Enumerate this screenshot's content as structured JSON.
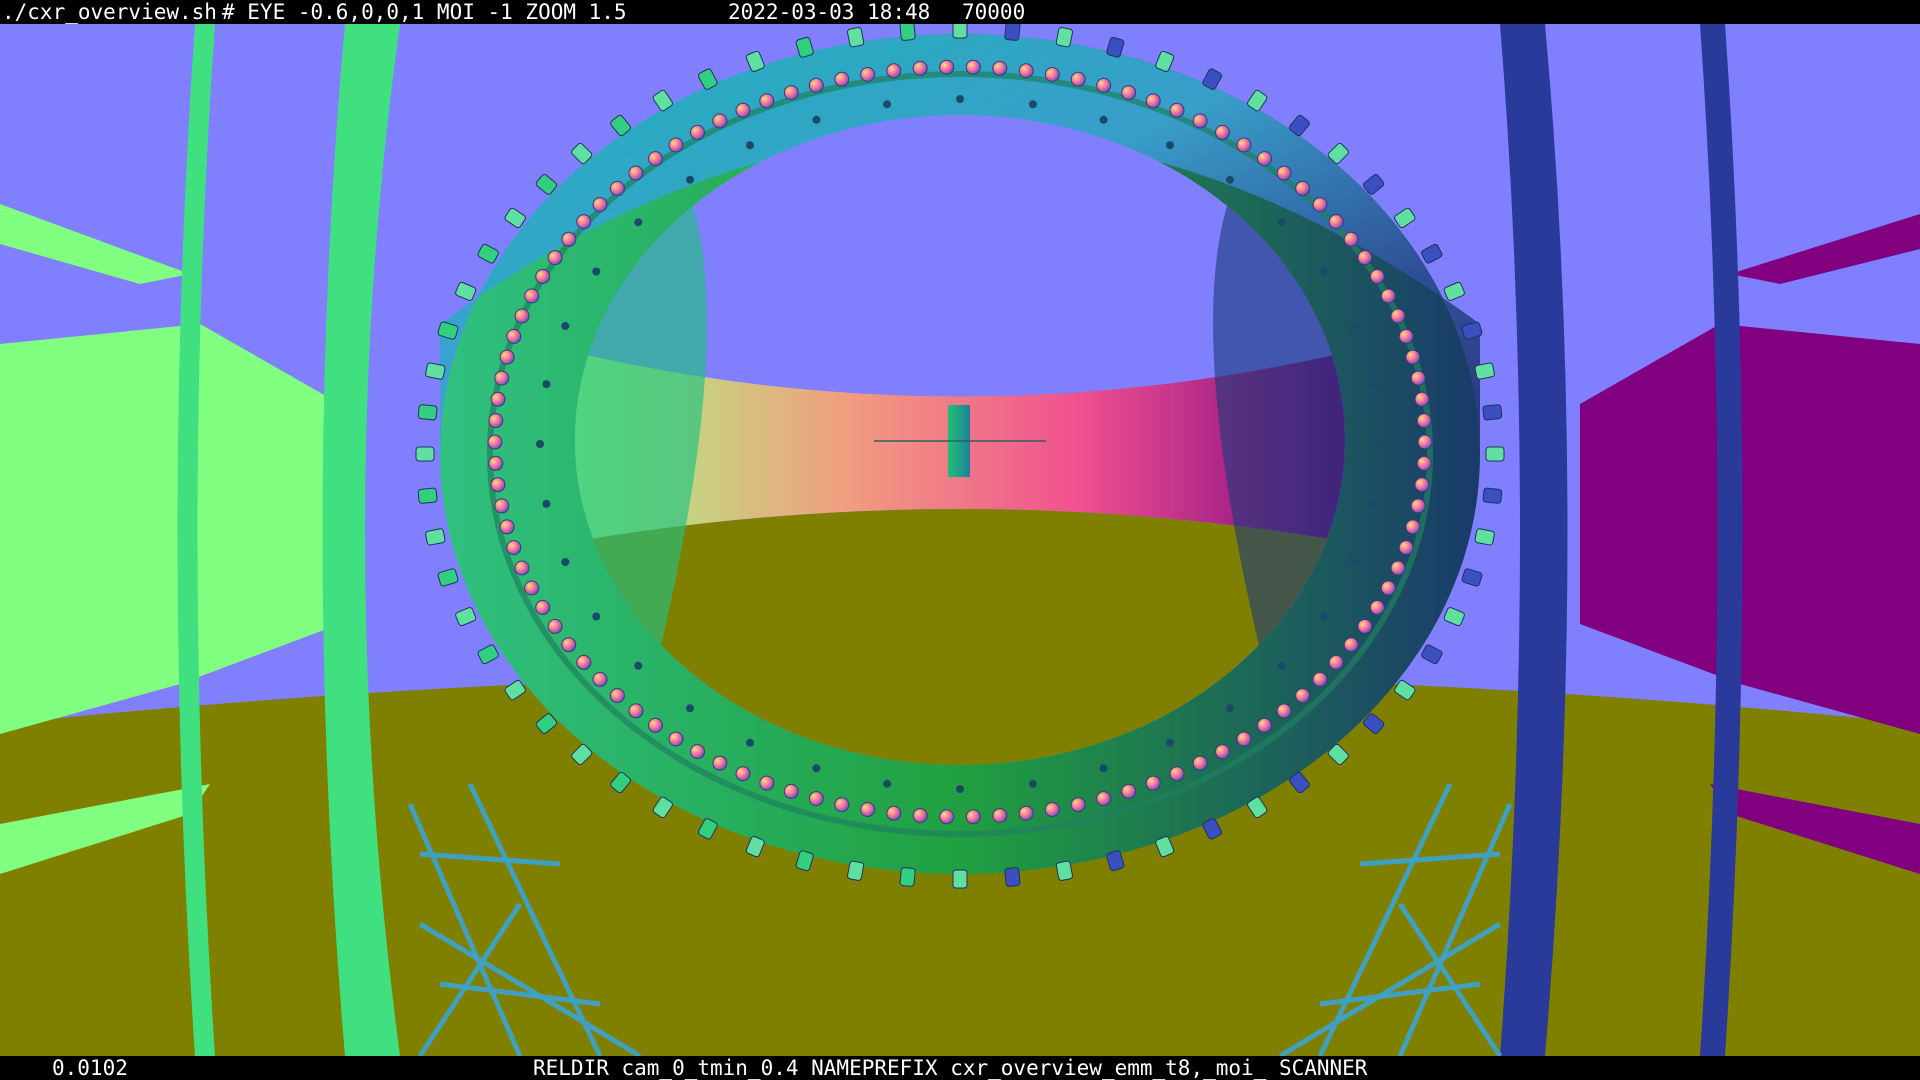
{
  "header": {
    "script_name": "./cxr_overview.sh",
    "command_args": "# EYE -0.6,0,0,1 MOI -1 ZOOM 1.5",
    "timestamp": "2022-03-03 18:48",
    "frame_value": "70000"
  },
  "footer": {
    "timing": "0.0102",
    "reldir_info": "RELDIR cam_0_tmin_0.4 NAMEPREFIX cxr_overview_emm_t8,_moi_ SCANNER"
  },
  "colors": {
    "sky": "#8080ff",
    "floor": "#808000",
    "left_wall": "#80ff80",
    "right_wall": "#800080",
    "left_pillar": "#40e080",
    "right_pillar": "#2a3a9a"
  },
  "scene": {
    "pmt_count": 110,
    "support_module_count": 64,
    "tick_marks": 36
  }
}
